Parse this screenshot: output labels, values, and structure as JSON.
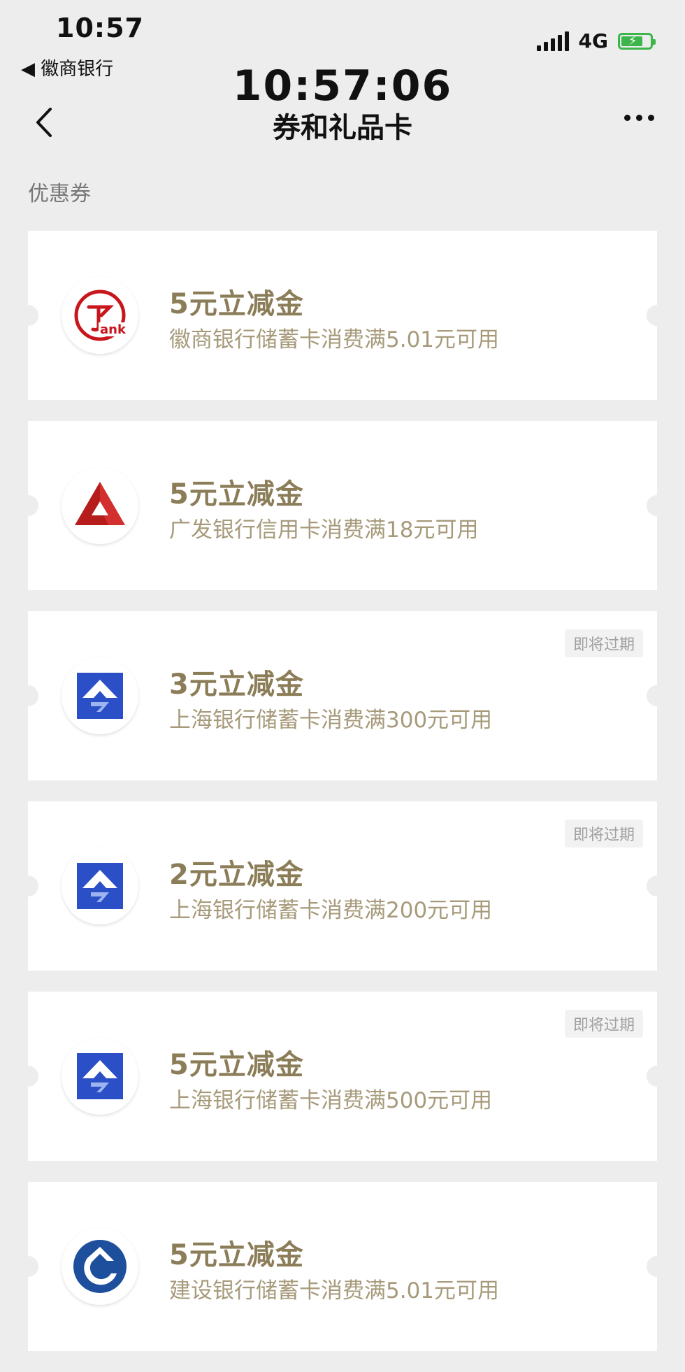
{
  "status_bar": {
    "time": "10:57",
    "back_app": "◀ 徽商银行",
    "network": "4G",
    "battery_color": "#3cb64a"
  },
  "overlay_clock": "10:57:06",
  "nav": {
    "title": "券和礼品卡"
  },
  "section_label": "优惠券",
  "colors": {
    "title_gold": "#8b7d58",
    "desc_gold": "#a69a7a",
    "background": "#ededed"
  },
  "coupons": [
    {
      "title": "5元立减金",
      "desc": "徽商银行储蓄卡消费满5.01元可用",
      "badge": "",
      "logo": "huishang-bank-logo"
    },
    {
      "title": "5元立减金",
      "desc": "广发银行信用卡消费满18元可用",
      "badge": "",
      "logo": "cgb-logo"
    },
    {
      "title": "3元立减金",
      "desc": "上海银行储蓄卡消费满300元可用",
      "badge": "即将过期",
      "logo": "bank-of-shanghai-logo"
    },
    {
      "title": "2元立减金",
      "desc": "上海银行储蓄卡消费满200元可用",
      "badge": "即将过期",
      "logo": "bank-of-shanghai-logo"
    },
    {
      "title": "5元立减金",
      "desc": "上海银行储蓄卡消费满500元可用",
      "badge": "即将过期",
      "logo": "bank-of-shanghai-logo"
    },
    {
      "title": "5元立减金",
      "desc": "建设银行储蓄卡消费满5.01元可用",
      "badge": "",
      "logo": "ccb-logo"
    }
  ]
}
